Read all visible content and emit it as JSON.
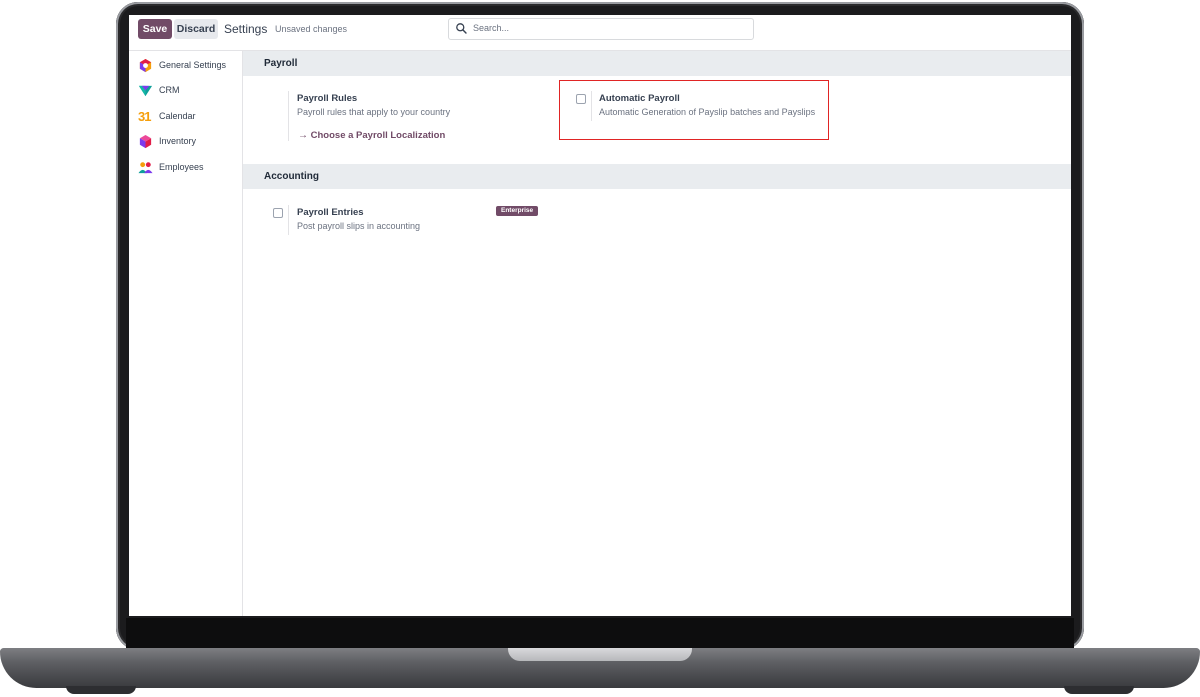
{
  "toolbar": {
    "save_label": "Save",
    "discard_label": "Discard",
    "title": "Settings",
    "status": "Unsaved changes"
  },
  "search": {
    "placeholder": "Search..."
  },
  "sidebar": {
    "items": [
      {
        "label": "General Settings",
        "icon": "general-settings-icon"
      },
      {
        "label": "CRM",
        "icon": "crm-icon"
      },
      {
        "label": "Calendar",
        "icon": "calendar-icon",
        "icon_text": "31"
      },
      {
        "label": "Inventory",
        "icon": "inventory-icon"
      },
      {
        "label": "Employees",
        "icon": "employees-icon"
      }
    ]
  },
  "sections": {
    "payroll": {
      "title": "Payroll",
      "payroll_rules": {
        "title": "Payroll Rules",
        "description": "Payroll rules that apply to your country",
        "action": "Choose a Payroll Localization"
      },
      "automatic_payroll": {
        "title": "Automatic Payroll",
        "description": "Automatic Generation of Payslip batches and Payslips",
        "checked": false
      }
    },
    "accounting": {
      "title": "Accounting",
      "payroll_entries": {
        "title": "Payroll Entries",
        "description": "Post payroll slips in accounting",
        "badge": "Enterprise",
        "checked": false
      }
    }
  },
  "colors": {
    "brand": "#714b67",
    "highlight": "#e02424",
    "section_bg": "#e9ecef"
  }
}
